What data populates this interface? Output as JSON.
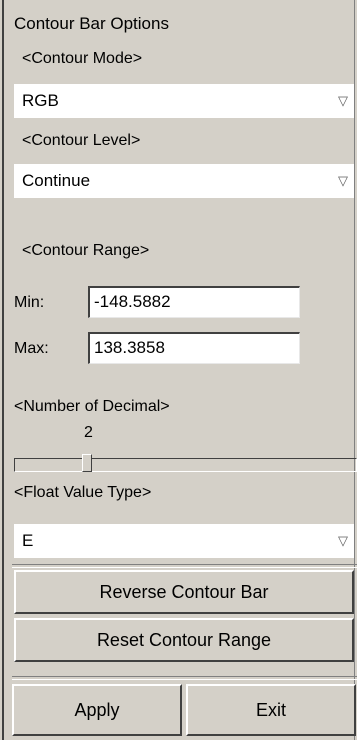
{
  "title": "Contour Bar Options",
  "contour_mode": {
    "heading": "<Contour Mode>",
    "value": "RGB"
  },
  "contour_level": {
    "heading": "<Contour Level>",
    "value": "Continue"
  },
  "contour_range": {
    "heading": "<Contour Range>",
    "min_label": "Min:",
    "min_value": "-148.5882",
    "max_label": "Max:",
    "max_value": "138.3858"
  },
  "decimal": {
    "heading": "<Number of Decimal>",
    "value": "2"
  },
  "float_type": {
    "heading": "<Float Value Type>",
    "value": "E"
  },
  "buttons": {
    "reverse": "Reverse Contour Bar",
    "reset": "Reset Contour Range",
    "apply": "Apply",
    "exit": "Exit"
  },
  "dropdown_arrow": "▽"
}
